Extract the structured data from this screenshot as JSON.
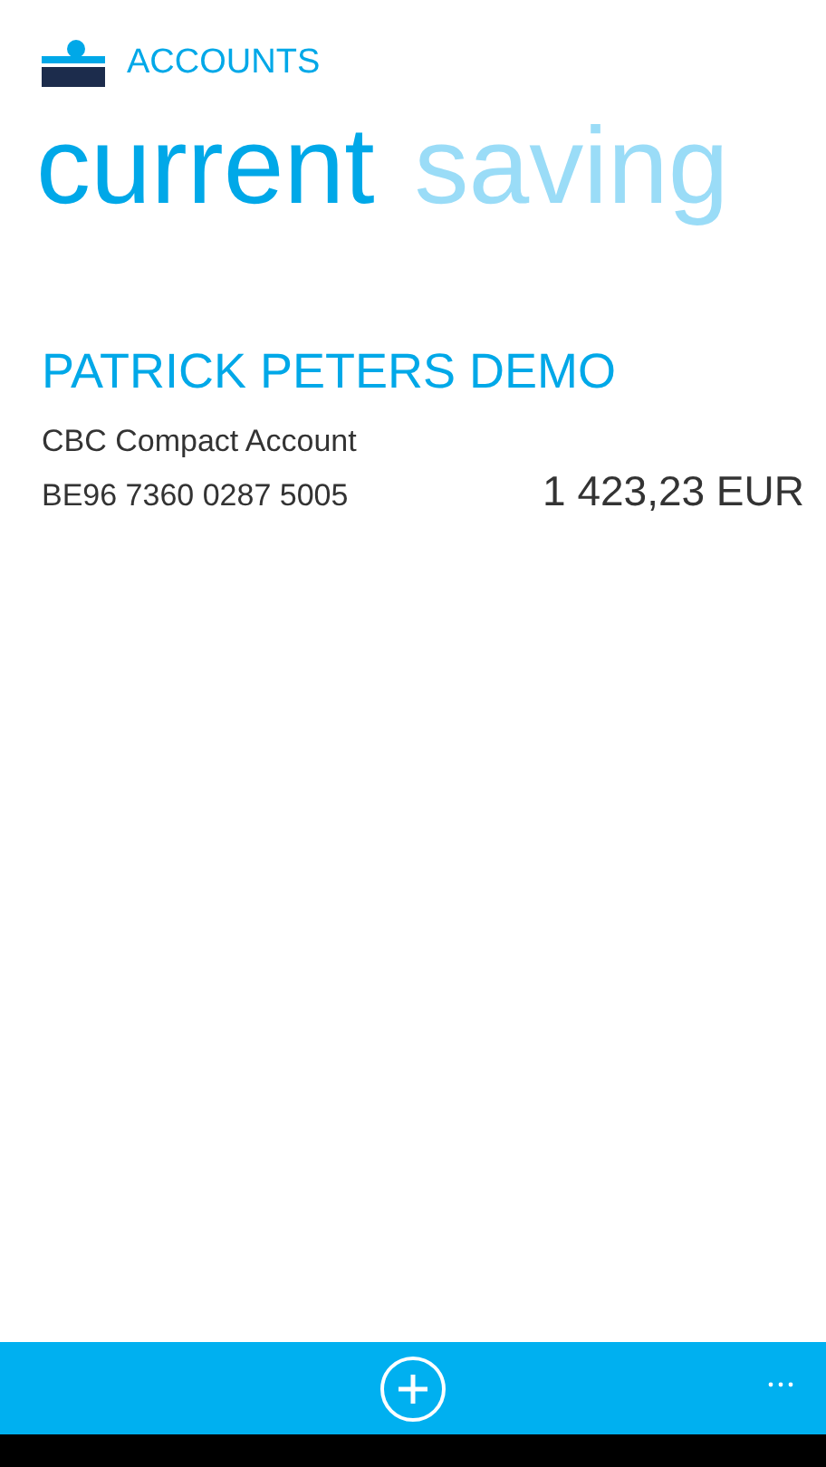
{
  "header": {
    "title": "ACCOUNTS"
  },
  "pivots": [
    {
      "label": "current",
      "selected": true
    },
    {
      "label": "saving",
      "selected": false
    }
  ],
  "accounts": [
    {
      "holder": "PATRICK PETERS DEMO",
      "product": "CBC Compact Account",
      "iban": "BE96 7360 0287 5005",
      "balance": "1 423,23 EUR"
    }
  ]
}
